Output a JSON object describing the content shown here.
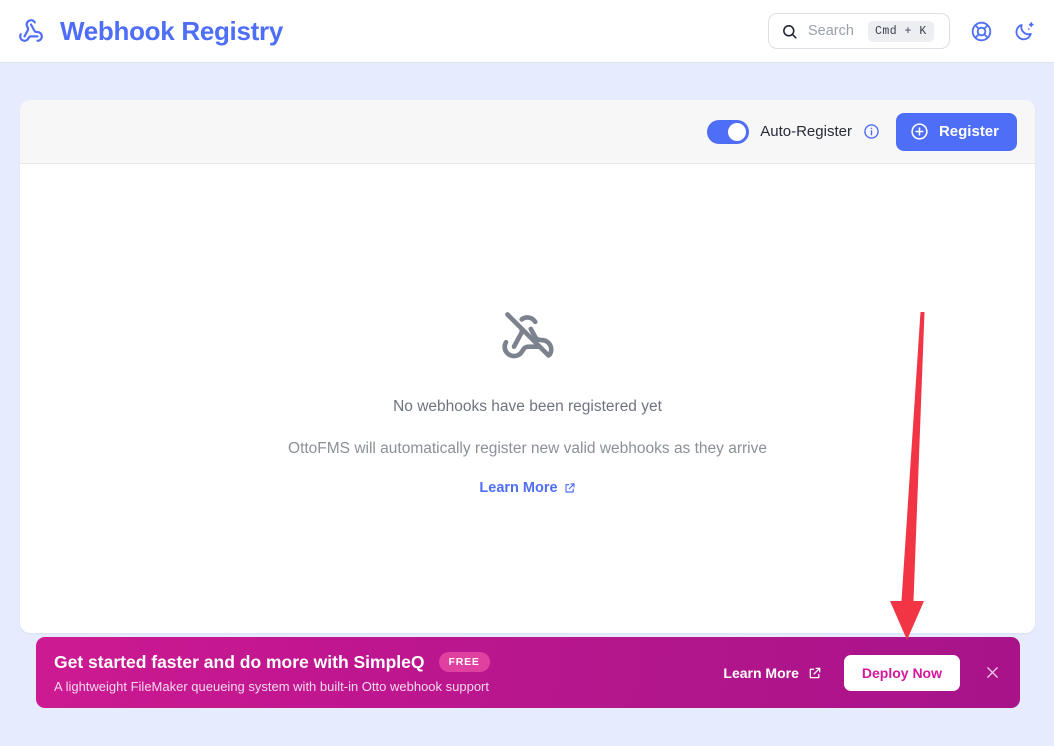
{
  "header": {
    "logo_icon": "webhook-icon",
    "title": "Webhook Registry",
    "search": {
      "icon": "search-icon",
      "placeholder": "Search",
      "shortcut": "Cmd + K"
    },
    "help_icon": "life-buoy-icon",
    "theme_icon": "moon-star-icon"
  },
  "toolbar": {
    "auto_register_label": "Auto-Register",
    "auto_register_on": true,
    "info_icon": "info-circle-icon",
    "register_label": "Register",
    "register_icon": "plus-circle-icon"
  },
  "empty_state": {
    "icon": "webhook-off-icon",
    "title": "No webhooks have been registered yet",
    "subtitle": "OttoFMS will automatically register new valid webhooks as they arrive",
    "link_label": "Learn More",
    "link_icon": "external-link-icon"
  },
  "banner": {
    "title": "Get started faster and do more with SimpleQ",
    "badge": "FREE",
    "subtitle": "A lightweight FileMaker queueing system with built-in Otto webhook support",
    "learn_more_label": "Learn More",
    "learn_more_icon": "external-link-icon",
    "cta_label": "Deploy Now",
    "close_icon": "close-icon"
  },
  "annotation": {
    "arrow_color": "#f23545",
    "arrow_direction": "down",
    "points_to": "Deploy Now"
  },
  "colors": {
    "accent": "#4f6ef7",
    "page_background": "#e6ecfd",
    "banner_start": "#cd1a92",
    "banner_end": "#a8138a",
    "badge": "#e0409f"
  }
}
